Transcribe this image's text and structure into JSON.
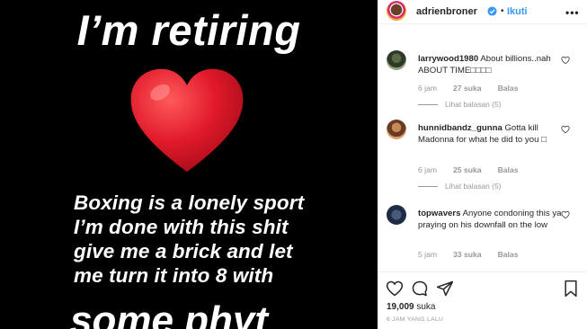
{
  "story": {
    "title": "I’m retiring",
    "body": "Boxing is a lonely sport\nI’m done with this shit\ngive me a brick and let\nme turn it into 8 with",
    "bottom": "some phyt"
  },
  "header": {
    "username": "adrienbroner",
    "dot": "•",
    "follow_label": "Ikuti",
    "more": "•••"
  },
  "comments": [
    {
      "username": "larrywood1980",
      "text": " About billions..nah ABOUT TIME□□□□",
      "time": "6 jam",
      "likes": "27 suka",
      "reply": "Balas",
      "replies": "Lihat balasan (5)"
    },
    {
      "username": "hunnidbandz_gunna",
      "text": " Gotta kill Madonna for what he did to you □",
      "time": "6 jam",
      "likes": "25 suka",
      "reply": "Balas",
      "replies": "Lihat balasan (5)"
    },
    {
      "username": "topwavers",
      "text": " Anyone condoning this ya praying on his downfall on the low",
      "time": "5 jam",
      "likes": "33 suka",
      "reply": "Balas"
    }
  ],
  "likes": {
    "count": "19,009",
    "label": " suka"
  },
  "time_ago": "6 JAM YANG LALU",
  "colors": {
    "link": "#3897f0",
    "heart": "#e0192b",
    "muted": "#999999"
  },
  "icons": [
    "verified-icon",
    "heart-icon",
    "comment-icon",
    "share-icon",
    "bookmark-icon"
  ]
}
